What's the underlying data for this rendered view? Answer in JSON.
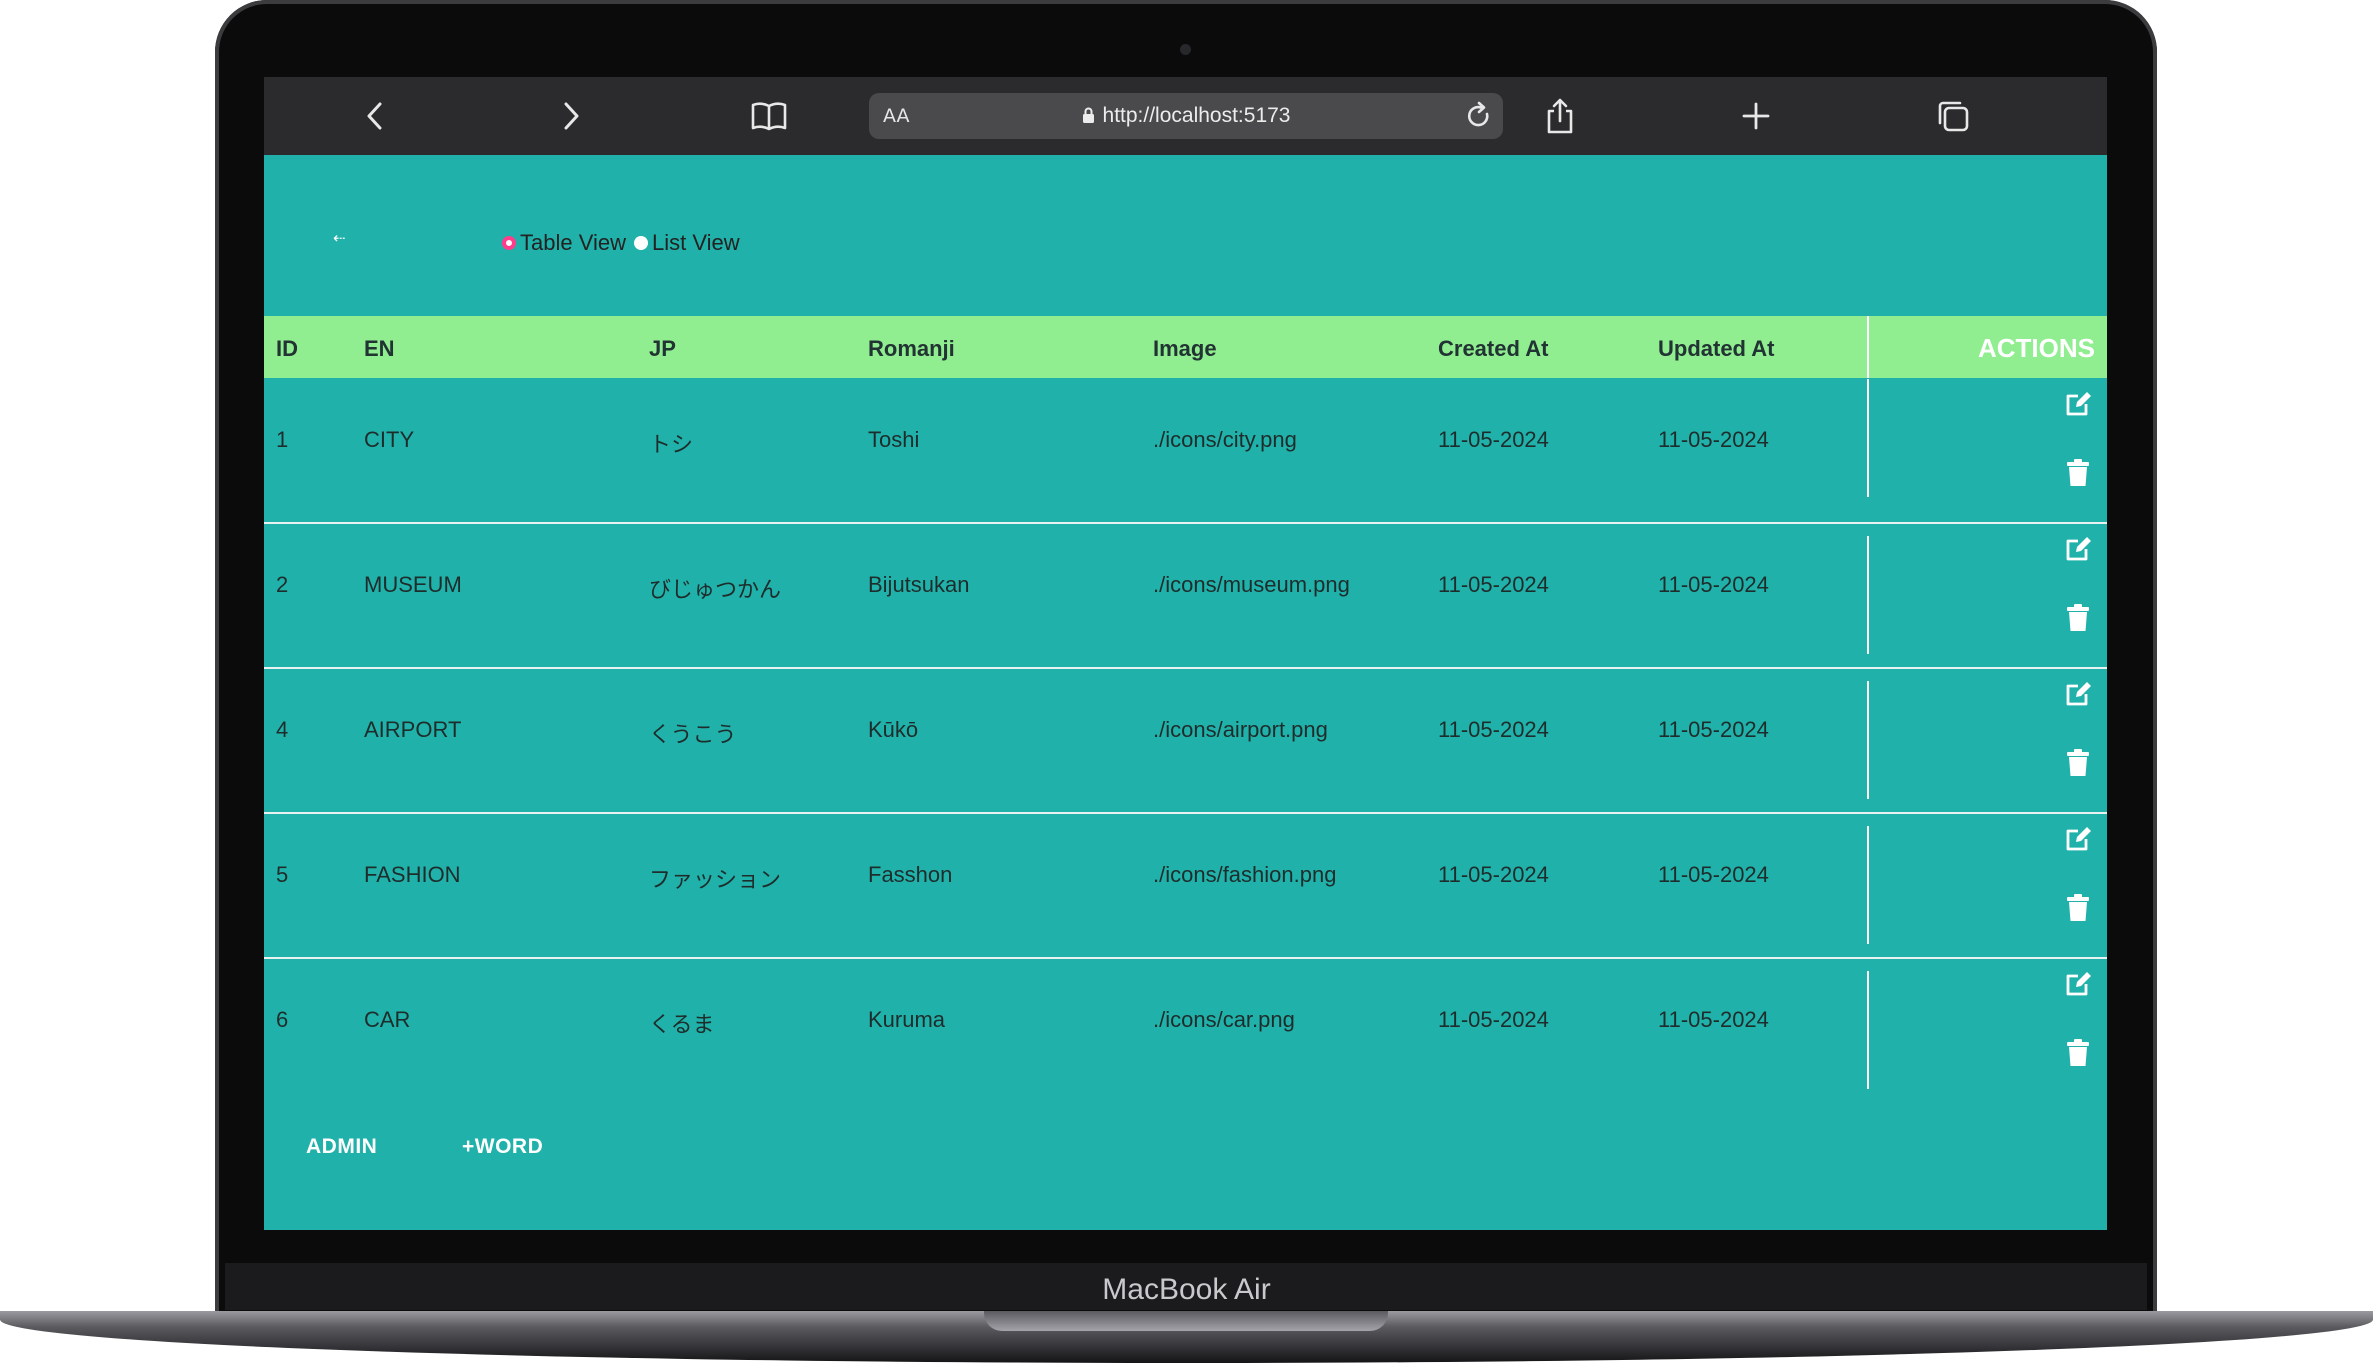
{
  "device": {
    "brand": "MacBook Air"
  },
  "browser": {
    "url": "http://localhost:5173",
    "text_size_label": "AA",
    "icons": [
      "chevron-left-icon",
      "chevron-right-icon",
      "book-icon",
      "lock-icon",
      "reload-icon",
      "share-icon",
      "plus-icon",
      "tabs-icon"
    ]
  },
  "page": {
    "back_label": "⇠",
    "view_options": [
      {
        "label": "Table View",
        "checked": true
      },
      {
        "label": "List View",
        "checked": false
      }
    ],
    "table": {
      "headers": [
        "ID",
        "EN",
        "JP",
        "Romanji",
        "Image",
        "Created At",
        "Updated At"
      ],
      "actions_header": "ACTIONS",
      "rows": [
        {
          "id": "1",
          "en": "CITY",
          "jp": "トシ",
          "romanji": "Toshi",
          "image": "./icons/city.png",
          "created": "11-05-2024",
          "updated": "11-05-2024"
        },
        {
          "id": "2",
          "en": "MUSEUM",
          "jp": "びじゅつかん",
          "romanji": "Bijutsukan",
          "image": "./icons/museum.png",
          "created": "11-05-2024",
          "updated": "11-05-2024"
        },
        {
          "id": "4",
          "en": "AIRPORT",
          "jp": "くうこう",
          "romanji": "Kūkō",
          "image": "./icons/airport.png",
          "created": "11-05-2024",
          "updated": "11-05-2024"
        },
        {
          "id": "5",
          "en": "FASHION",
          "jp": "ファッション",
          "romanji": "Fasshon",
          "image": "./icons/fashion.png",
          "created": "11-05-2024",
          "updated": "11-05-2024"
        },
        {
          "id": "6",
          "en": "CAR",
          "jp": "くるま",
          "romanji": "Kuruma",
          "image": "./icons/car.png",
          "created": "11-05-2024",
          "updated": "11-05-2024"
        }
      ]
    },
    "admin_label": "ADMIN",
    "add_word_label": "+WORD"
  },
  "colors": {
    "page_bg": "#20b2aa",
    "header_bg": "#90ee90",
    "radio_checked": "#ff3d8b",
    "toolbar_bg": "#2b2b2d"
  }
}
